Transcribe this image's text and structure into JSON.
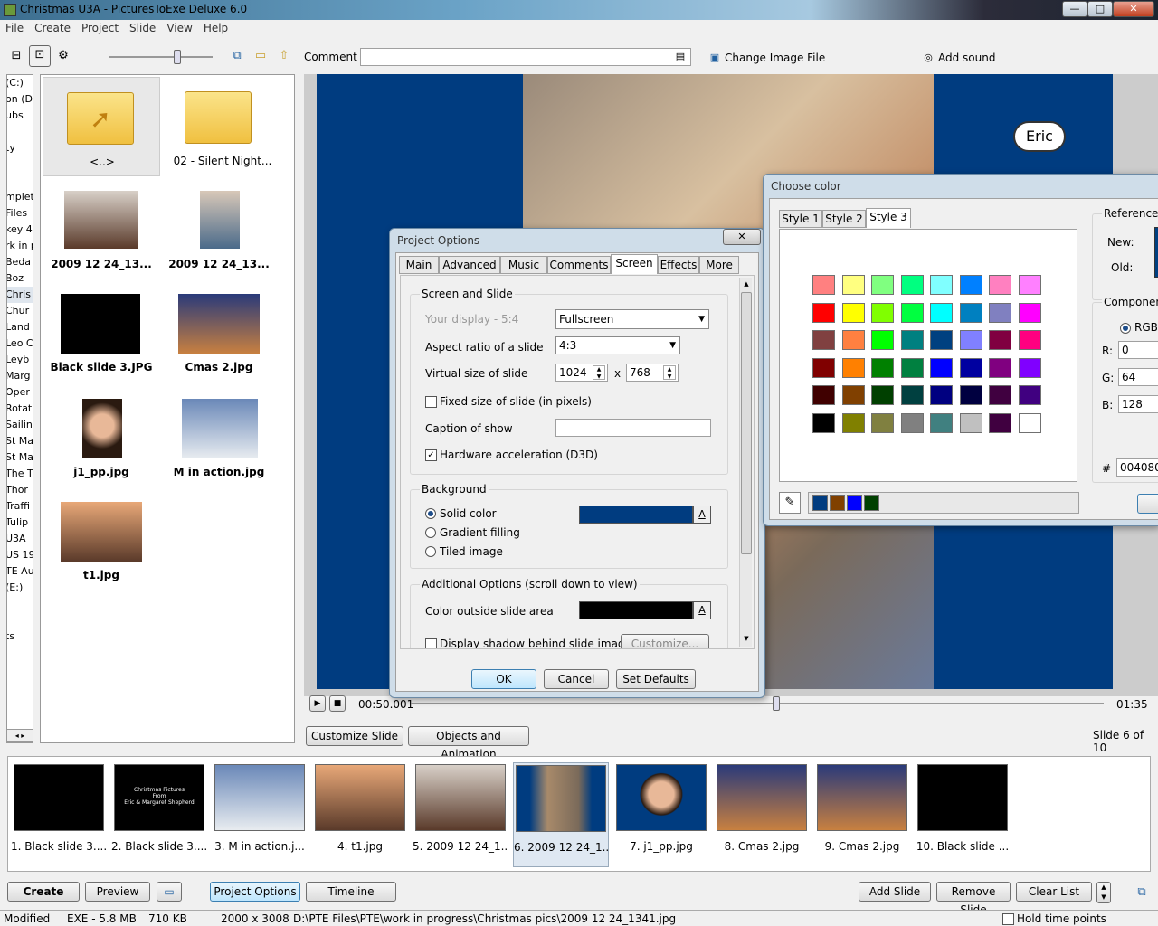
{
  "window": {
    "title": "Christmas U3A - PicturesToExe Deluxe 6.0",
    "min": "—",
    "max": "□",
    "close": "✕"
  },
  "menu": [
    "File",
    "Create",
    "Project",
    "Slide",
    "View",
    "Help"
  ],
  "toolbar": {
    "comment_label": "Comment",
    "comment_value": "",
    "change_image_label": "Change Image File",
    "add_sound_label": "Add sound"
  },
  "tree": [
    "(C:)",
    "on (D",
    "ubs",
    "",
    "ty",
    "",
    "",
    "mplet",
    "Files",
    "key 4",
    "rk in p",
    "Beda",
    "Boz",
    "Chris",
    "Chur",
    "Land",
    "Leo C",
    "Leyb",
    "Marg",
    "Oper",
    "Rotat",
    "Sailin",
    "St Ma",
    "St Ma",
    "The T",
    "Thor",
    "Traffi",
    "Tulip",
    "U3A",
    "US 19",
    "TE Au",
    "(E:)",
    "",
    "",
    "ts"
  ],
  "browser": {
    "items": [
      {
        "label": "<..>"
      },
      {
        "label": "02 - Silent Night..."
      },
      {
        "label": "2009 12 24_13..."
      },
      {
        "label": "2009 12 24_13..."
      },
      {
        "label": "Black slide 3.JPG"
      },
      {
        "label": "Cmas 2.jpg"
      },
      {
        "label": "j1_pp.jpg"
      },
      {
        "label": "M in action.jpg"
      },
      {
        "label": "t1.jpg"
      }
    ]
  },
  "preview": {
    "eric_label": "Eric",
    "time_current": "00:50.001",
    "time_total": "01:35",
    "slide_info": "Slide 6 of 10",
    "customize_label": "Customize Slide",
    "objects_label": "Objects and Animation"
  },
  "strip": [
    {
      "label": "1. Black slide 3....",
      "color": "#000000"
    },
    {
      "label": "2. Black slide 3....",
      "color": "#000000",
      "line1": "Christmas Pictures",
      "line2": "From",
      "line3": "Eric & Margaret Shepherd"
    },
    {
      "label": "3. M in action.j...",
      "color": "#a8b6c8"
    },
    {
      "label": "4. t1.jpg",
      "color": "#c88b5a"
    },
    {
      "label": "5. 2009 12 24_1...",
      "color": "#8c6e5a"
    },
    {
      "label": "6. 2009 12 24_1...",
      "color": "#003c80"
    },
    {
      "label": "7. j1_pp.jpg",
      "color": "#003c80"
    },
    {
      "label": "8. Cmas 2.jpg",
      "color": "#5a4a6a"
    },
    {
      "label": "9. Cmas 2.jpg",
      "color": "#5a4a6a"
    },
    {
      "label": "10. Black slide ...",
      "color": "#000000"
    }
  ],
  "bottom": {
    "create": "Create",
    "preview": "Preview",
    "project_options": "Project Options",
    "timeline": "Timeline",
    "add_slide": "Add Slide",
    "remove_slide": "Remove Slide",
    "clear_list": "Clear List"
  },
  "status": {
    "state": "Modified",
    "exe": "EXE - 5.8 MB",
    "size": "710 KB",
    "dims": "2000 x 3008",
    "path": "D:\\PTE Files\\PTE\\work in progress\\Christmas pics\\2009 12 24_1341.jpg",
    "hold": "Hold time points"
  },
  "project_options": {
    "title": "Project Options",
    "tabs": [
      "Main",
      "Advanced",
      "Music",
      "Comments",
      "Screen",
      "Effects",
      "More"
    ],
    "group1": "Screen and Slide",
    "your_display": "Your display - 5:4",
    "display_mode": "Fullscreen",
    "aspect_label": "Aspect ratio of a slide",
    "aspect_value": "4:3",
    "virtual_label": "Virtual size of slide",
    "virtual_w": "1024",
    "virtual_x": "x",
    "virtual_h": "768",
    "fixed_label": "Fixed size of slide (in pixels)",
    "caption_label": "Caption of show",
    "caption_value": "",
    "hwaccel_label": "Hardware acceleration (D3D)",
    "group2": "Background",
    "solid": "Solid color",
    "gradient": "Gradient filling",
    "tiled": "Tiled image",
    "bg_color": "#003c80",
    "group3": "Additional Options (scroll down to view)",
    "outside_label": "Color outside slide area",
    "outside_color": "#000000",
    "shadow_label": "Display shadow behind slide imag",
    "customize_label": "Customize...",
    "ok": "OK",
    "cancel": "Cancel",
    "defaults": "Set Defaults",
    "swatch_btn": "A"
  },
  "choose_color": {
    "title": "Choose color",
    "tabs": [
      "Style 1",
      "Style 2",
      "Style 3"
    ],
    "grid": [
      [
        "#ff8080",
        "#ffff80",
        "#80ff80",
        "#00ff80",
        "#80ffff",
        "#0080ff",
        "#ff80c0",
        "#ff80ff"
      ],
      [
        "#ff0000",
        "#ffff00",
        "#80ff00",
        "#00ff40",
        "#00ffff",
        "#0080c0",
        "#8080c0",
        "#ff00ff"
      ],
      [
        "#804040",
        "#ff8040",
        "#00ff00",
        "#008080",
        "#004080",
        "#8080ff",
        "#800040",
        "#ff0080"
      ],
      [
        "#800000",
        "#ff8000",
        "#008000",
        "#008040",
        "#0000ff",
        "#0000a0",
        "#800080",
        "#8000ff"
      ],
      [
        "#400000",
        "#804000",
        "#004000",
        "#004040",
        "#000080",
        "#000040",
        "#400040",
        "#400080"
      ],
      [
        "#000000",
        "#808000",
        "#808040",
        "#808080",
        "#408080",
        "#c0c0c0",
        "#400040",
        "#ffffff"
      ]
    ],
    "recent": [
      "#003c80",
      "#804000",
      "#0000ff",
      "#004000"
    ],
    "reference": "Reference",
    "new_label": "New:",
    "old_label": "Old:",
    "new_color": "#004080",
    "components": "Components",
    "rgb": "RGB",
    "r_label": "R:",
    "r": "0",
    "g_label": "G:",
    "g": "64",
    "b_label": "B:",
    "b": "128",
    "hash": "#",
    "hex": "004080"
  }
}
